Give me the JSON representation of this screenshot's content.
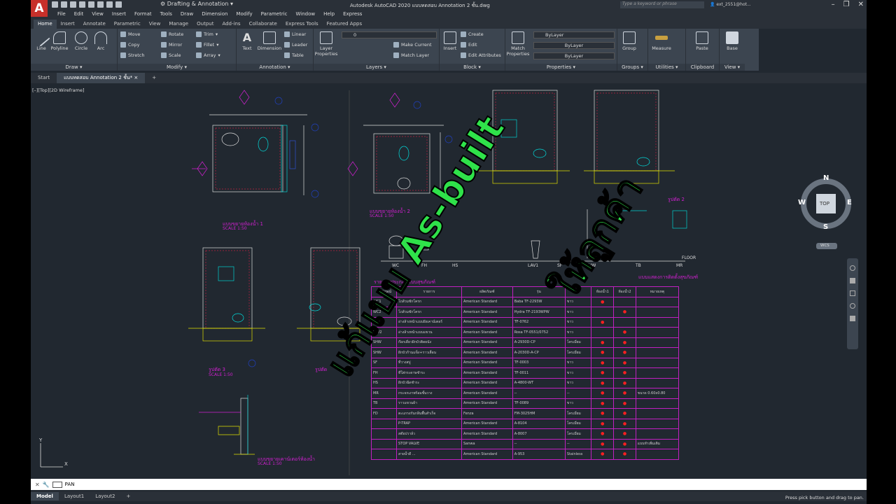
{
  "app": {
    "logo": "A",
    "workspace": "Drafting & Annotation",
    "title": "Autodesk AutoCAD 2020   แบบทดสอบ Annotation 2 ชั้น.dwg",
    "search_placeholder": "Type a keyword or phrase",
    "user": "ext_2551@hot..."
  },
  "menu": [
    "File",
    "Edit",
    "View",
    "Insert",
    "Format",
    "Tools",
    "Draw",
    "Dimension",
    "Modify",
    "Parametric",
    "Window",
    "Help",
    "Express"
  ],
  "ribbon_tabs": [
    "Home",
    "Insert",
    "Annotate",
    "Parametric",
    "View",
    "Manage",
    "Output",
    "Add-ins",
    "Collaborate",
    "Express Tools",
    "Featured Apps"
  ],
  "ribbon": {
    "draw": {
      "title": "Draw",
      "line": "Line",
      "polyline": "Polyline",
      "circle": "Circle",
      "arc": "Arc"
    },
    "modify": {
      "title": "Modify",
      "move": "Move",
      "rotate": "Rotate",
      "trim": "Trim",
      "copy": "Copy",
      "mirror": "Mirror",
      "fillet": "Fillet",
      "stretch": "Stretch",
      "scale": "Scale",
      "array": "Array"
    },
    "annotation": {
      "title": "Annotation",
      "text": "Text",
      "dimension": "Dimension",
      "linear": "Linear",
      "leader": "Leader",
      "table": "Table"
    },
    "layers": {
      "title": "Layers",
      "layer_properties": "Layer Properties",
      "current": "0",
      "make_current": "Make Current",
      "match_layer": "Match Layer"
    },
    "block": {
      "title": "Block",
      "insert": "Insert",
      "create": "Create",
      "edit": "Edit",
      "edit_attributes": "Edit Attributes"
    },
    "properties": {
      "title": "Properties",
      "match_properties": "Match Properties",
      "bylayer1": "ByLayer",
      "bylayer2": "ByLayer",
      "bylayer3": "ByLayer"
    },
    "groups": {
      "title": "Groups",
      "group": "Group"
    },
    "utilities": {
      "title": "Utilities",
      "measure": "Measure"
    },
    "clipboard": {
      "title": "Clipboard",
      "paste": "Paste"
    },
    "view": {
      "title": "View",
      "base": "Base"
    }
  },
  "doc_tabs": [
    "Start",
    "แบบทดสอบ Annotation 2 ชั้น*"
  ],
  "view_label": "[–][Top][2D Wireframe]",
  "viewcube": {
    "n": "N",
    "s": "S",
    "e": "E",
    "w": "W",
    "top": "TOP",
    "wcs": "WCS"
  },
  "overlay": {
    "line1": "แก้แบบ As-built",
    "line2": "ให้ลูกค้า"
  },
  "drawing_labels": {
    "plan1": "แบบขยายห้องน้ำ 1",
    "plan2": "แบบขยายห้องน้ำ 2",
    "section3": "รูปตัด 3",
    "section4": "รูปตัด",
    "section2": "รูปตัด 2",
    "counter": "แบบขยายเคาน์เตอร์ห้องน้ำ",
    "install": "แบบแสดงการติดตั้งสุขภัณฑ์",
    "schedule": "รายการประกอบแบบสุขภัณฑ์",
    "scale": "SCALE 1:50",
    "floor": "FLOOR",
    "fixtures": [
      "WC",
      "FH",
      "HS",
      "LAV1",
      "SF",
      "SHW",
      "TB",
      "MR"
    ]
  },
  "schedule": {
    "headers": [
      "สัญลักษณ์",
      "รายการ",
      "ผลิตภัณฑ์",
      "รุ่น",
      "สี",
      "ห้องน้ำ1",
      "ห้องน้ำ2",
      "หมายเหตุ"
    ],
    "rows": [
      [
        "WC1",
        "โถส้วมชักโครก",
        "American Standard",
        "Baba TF-2293W",
        "ขาว",
        "●",
        "",
        ""
      ],
      [
        "WC2",
        "โถส้วมชักโครก",
        "American Standard",
        "Hydra TF-2193WPW",
        "ขาว",
        "",
        "●",
        ""
      ],
      [
        "LAV1",
        "อ่างล้างหน้าแบบฝังเคาน์เตอร์",
        "American Standard",
        "TF-0762",
        "ขาว",
        "●",
        "",
        ""
      ],
      [
        "LAV2",
        "อ่างล้างหน้าแบบแขวน",
        "American Standard",
        "Rosa TF-0551/0752",
        "ขาว",
        "",
        "●",
        ""
      ],
      [
        "SHW",
        "ก๊อกเดี่ยวฝักบัวติดผนัง",
        "American Standard",
        "A-2930D-CP",
        "โครเมี่ยม",
        "●",
        "●",
        ""
      ],
      [
        "SHW",
        "ฝักบัวก้านแข็ง+ราวเลื่อน",
        "American Standard",
        "A-2030D-A-CP",
        "โครเมี่ยม",
        "●",
        "●",
        ""
      ],
      [
        "SF",
        "ที่วางสบู่",
        "American Standard",
        "TF-0003",
        "ขาว",
        "●",
        "●",
        ""
      ],
      [
        "FH",
        "ที่ใส่กระดาษชำระ",
        "American Standard",
        "TF-0011",
        "ขาว",
        "●",
        "●",
        ""
      ],
      [
        "HS",
        "ฝักบัวฉีดชำระ",
        "American Standard",
        "A-4800-WT",
        "ขาว",
        "●",
        "●",
        ""
      ],
      [
        "MR",
        "กระจกเงาพร้อมชั้นวาง",
        "American Standard",
        "--",
        "--",
        "●",
        "●",
        "ขนาด 0.60x0.80"
      ],
      [
        "TB",
        "ราวแขวนผ้า",
        "American Standard",
        "TF-0089",
        "ขาว",
        "●",
        "●",
        ""
      ],
      [
        "FD",
        "ตะแกรงกันกลิ่นพื้นสำเร็จ",
        "Fenza",
        "FM-3025HM",
        "โครเมี่ยม",
        "●",
        "●",
        ""
      ],
      [
        "",
        "P-TRAP",
        "American Standard",
        "A-8104",
        "โครเมี่ยม",
        "●",
        "●",
        ""
      ],
      [
        "",
        "สต๊อปวาล์ว",
        "American Standard",
        "A-8007",
        "โครเมี่ยม",
        "●",
        "●",
        ""
      ],
      [
        "",
        "STOP VALVE",
        "Sanwa",
        "--",
        "--",
        "●",
        "●",
        "แบบทำเพิ่มเติม"
      ],
      [
        "",
        "สายน้ำดี ...",
        "American Standard",
        "A-953",
        "Stainless",
        "●",
        "●",
        ""
      ]
    ]
  },
  "command": {
    "text": "PAN"
  },
  "layout_tabs": [
    "Model",
    "Layout1",
    "Layout2"
  ],
  "status": "Press pick button and drag to pan."
}
